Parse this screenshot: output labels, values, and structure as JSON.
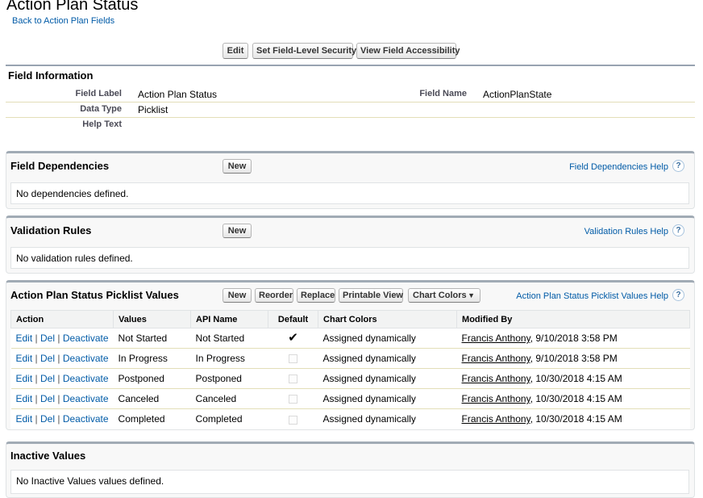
{
  "header": {
    "title": "Action Plan Status",
    "back_link": "Back to Action Plan Fields"
  },
  "toolbar": {
    "edit": "Edit",
    "set_fls": "Set Field-Level Security",
    "view_access": "View Field Accessibility"
  },
  "field_info": {
    "title": "Field Information",
    "field_label_label": "Field Label",
    "field_label_value": "Action Plan Status",
    "field_name_label": "Field Name",
    "field_name_value": "ActionPlanState",
    "data_type_label": "Data Type",
    "data_type_value": "Picklist",
    "help_text_label": "Help Text"
  },
  "dependencies": {
    "title": "Field Dependencies",
    "new_button": "New",
    "help": "Field Dependencies Help",
    "empty": "No dependencies defined."
  },
  "validation": {
    "title": "Validation Rules",
    "new_button": "New",
    "help": "Validation Rules Help",
    "empty": "No validation rules defined."
  },
  "picklist": {
    "title": "Action Plan Status Picklist Values",
    "buttons": {
      "new": "New",
      "reorder": "Reorder",
      "replace": "Replace",
      "printable": "Printable View",
      "chart_colors": "Chart Colors"
    },
    "help": "Action Plan Status Picklist Values Help",
    "columns": [
      "Action",
      "Values",
      "API Name",
      "Default",
      "Chart Colors",
      "Modified By"
    ],
    "action_labels": {
      "edit": "Edit",
      "del": "Del",
      "deactivate": "Deactivate",
      "sep": "|"
    },
    "rows": [
      {
        "value": "Not Started",
        "api": "Not Started",
        "default": true,
        "color": "Assigned dynamically",
        "user": "Francis Anthony",
        "date": ", 9/10/2018 3:58 PM"
      },
      {
        "value": "In Progress",
        "api": "In Progress",
        "default": false,
        "color": "Assigned dynamically",
        "user": "Francis Anthony",
        "date": ", 9/10/2018 3:58 PM"
      },
      {
        "value": "Postponed",
        "api": "Postponed",
        "default": false,
        "color": "Assigned dynamically",
        "user": "Francis Anthony",
        "date": ", 10/30/2018 4:15 AM"
      },
      {
        "value": "Canceled",
        "api": "Canceled",
        "default": false,
        "color": "Assigned dynamically",
        "user": "Francis Anthony",
        "date": ", 10/30/2018 4:15 AM"
      },
      {
        "value": "Completed",
        "api": "Completed",
        "default": false,
        "color": "Assigned dynamically",
        "user": "Francis Anthony",
        "date": ", 10/30/2018 4:15 AM"
      }
    ]
  },
  "inactive": {
    "title": "Inactive Values",
    "empty": "No Inactive Values values defined."
  }
}
